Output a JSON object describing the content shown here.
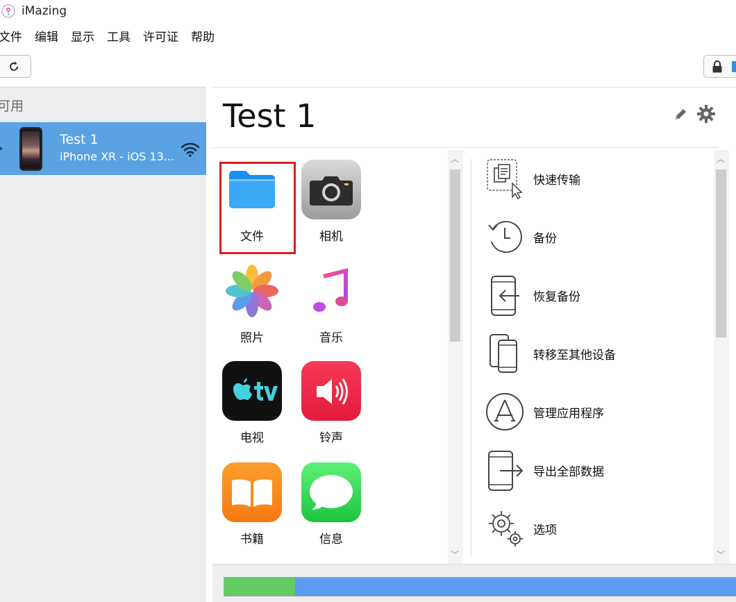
{
  "window": {
    "title": "iMazing"
  },
  "menu": [
    "文件",
    "编辑",
    "显示",
    "工具",
    "许可证",
    "帮助"
  ],
  "sidebar": {
    "header": "可用",
    "device": {
      "name": "Test 1",
      "subtitle": "iPhone XR - iOS 13..."
    }
  },
  "main": {
    "title": "Test 1",
    "apps": [
      {
        "label": "文件",
        "icon": "files-folder-icon",
        "selected": true
      },
      {
        "label": "相机",
        "icon": "camera-icon"
      },
      {
        "label": "照片",
        "icon": "photos-icon"
      },
      {
        "label": "音乐",
        "icon": "music-icon"
      },
      {
        "label": "电视",
        "icon": "apple-tv-icon"
      },
      {
        "label": "铃声",
        "icon": "ringtones-icon"
      },
      {
        "label": "书籍",
        "icon": "books-icon"
      },
      {
        "label": "信息",
        "icon": "messages-icon"
      }
    ],
    "actions": [
      {
        "label": "快速传输",
        "icon": "quick-transfer-icon"
      },
      {
        "label": "备份",
        "icon": "backup-icon"
      },
      {
        "label": "恢复备份",
        "icon": "restore-backup-icon"
      },
      {
        "label": "转移至其他设备",
        "icon": "transfer-device-icon"
      },
      {
        "label": "管理应用程序",
        "icon": "app-store-icon"
      },
      {
        "label": "导出全部数据",
        "icon": "export-data-icon"
      },
      {
        "label": "选项",
        "icon": "options-gear-icon"
      }
    ]
  },
  "storage": {
    "used_fraction": 0.135
  },
  "colors": {
    "selection": "#5aa2e2",
    "highlight_box": "#e01b1b",
    "storage_used": "#62cc62",
    "storage_free": "#5b9df0"
  }
}
